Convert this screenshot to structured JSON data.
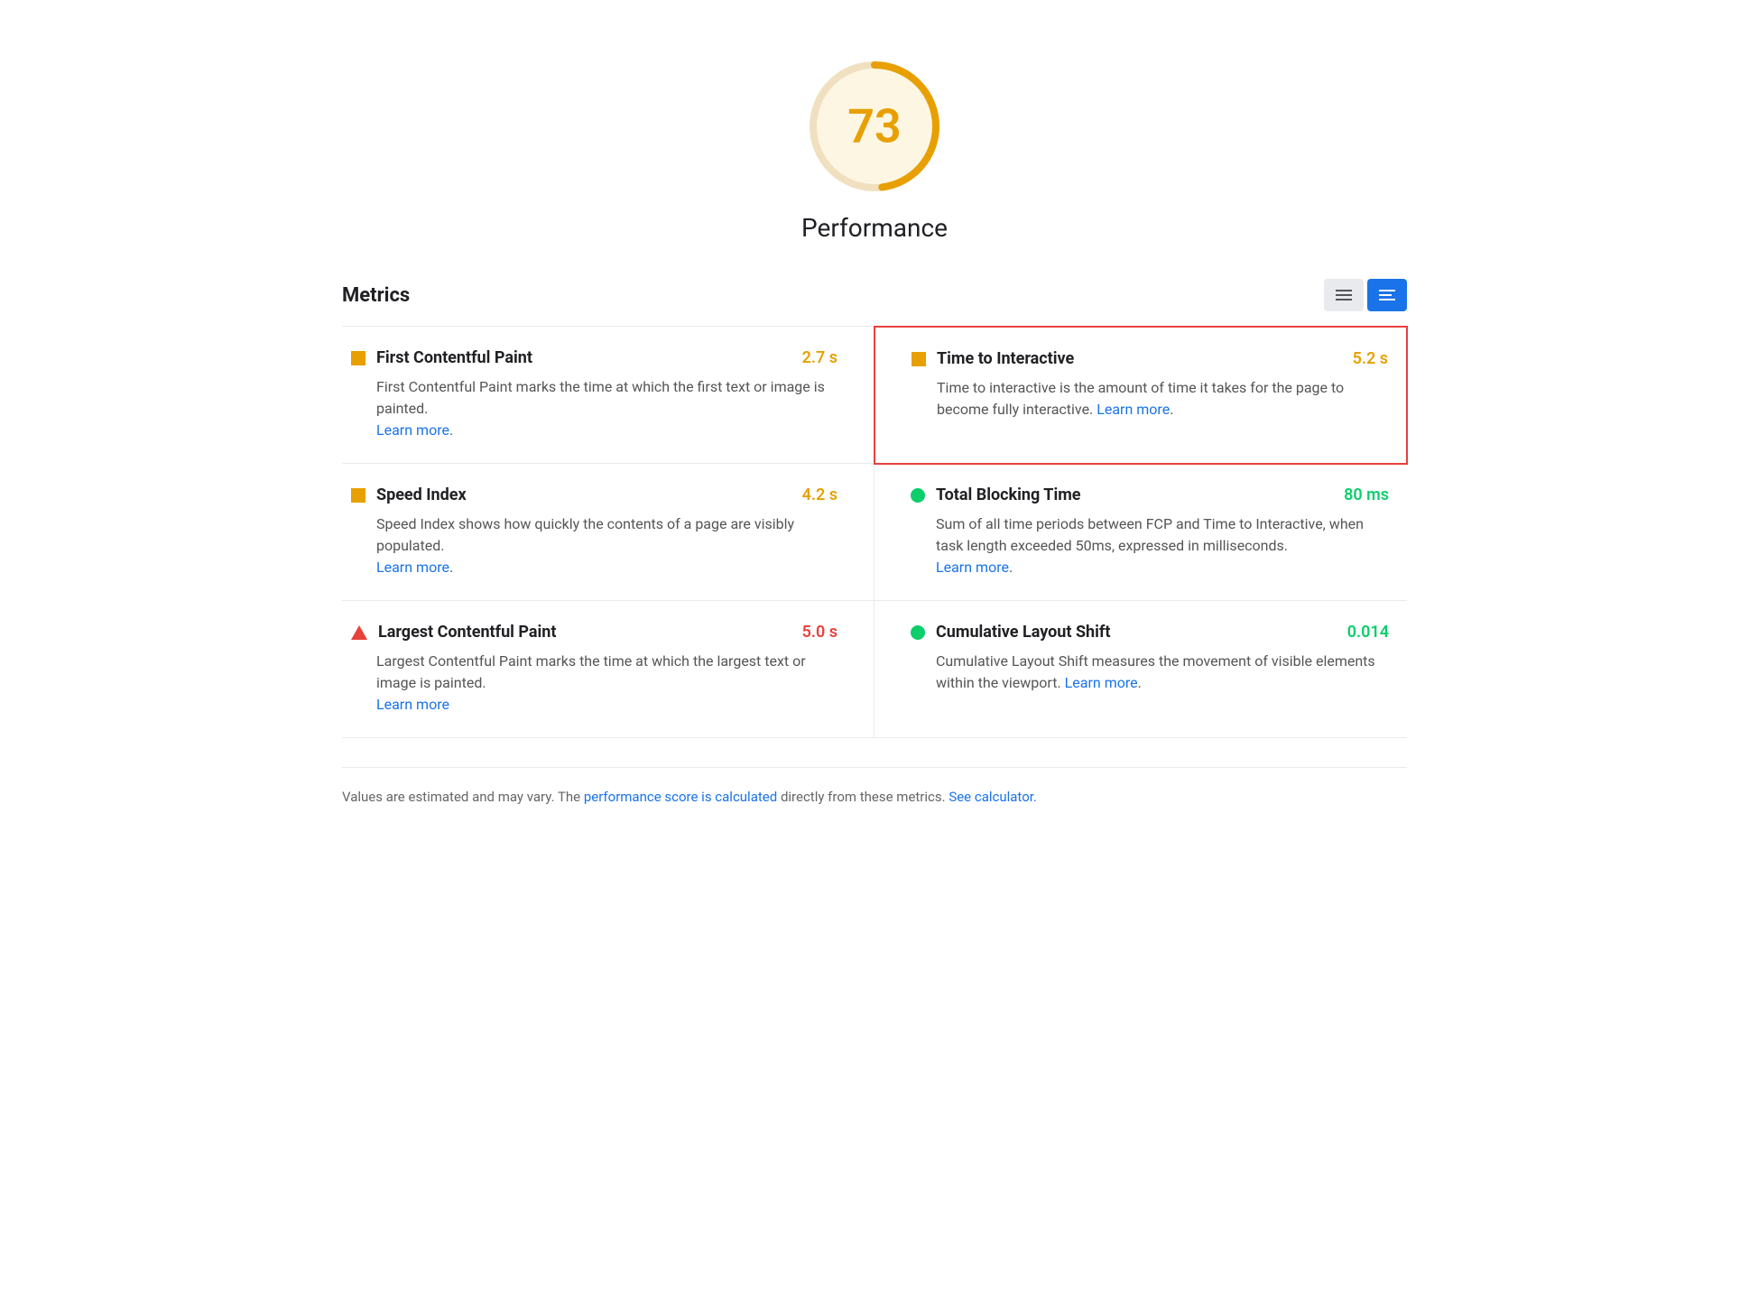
{
  "score": {
    "value": "73",
    "label": "Performance",
    "ring_color": "#e8a000",
    "bg_color": "#fdf6e3"
  },
  "metrics_section": {
    "title": "Metrics",
    "view_toggle": {
      "list_label": "list-view",
      "detail_label": "detail-view"
    }
  },
  "metrics": [
    {
      "id": "fcp",
      "name": "First Contentful Paint",
      "description": "First Contentful Paint marks the time at which the first text or image is painted.",
      "value": "2.7 s",
      "value_color": "orange",
      "icon_type": "square",
      "learn_more_url": "#",
      "learn_more_label": "Learn more",
      "highlighted": false
    },
    {
      "id": "tti",
      "name": "Time to Interactive",
      "description": "Time to interactive is the amount of time it takes for the page to become fully interactive.",
      "value": "5.2 s",
      "value_color": "orange",
      "icon_type": "square",
      "learn_more_url": "#",
      "learn_more_label": "Learn more",
      "highlighted": true
    },
    {
      "id": "si",
      "name": "Speed Index",
      "description": "Speed Index shows how quickly the contents of a page are visibly populated.",
      "value": "4.2 s",
      "value_color": "orange",
      "icon_type": "square",
      "learn_more_url": "#",
      "learn_more_label": "Learn more",
      "highlighted": false
    },
    {
      "id": "tbt",
      "name": "Total Blocking Time",
      "description": "Sum of all time periods between FCP and Time to Interactive, when task length exceeded 50ms, expressed in milliseconds.",
      "value": "80 ms",
      "value_color": "green",
      "icon_type": "circle",
      "learn_more_url": "#",
      "learn_more_label": "Learn more",
      "highlighted": false
    },
    {
      "id": "lcp",
      "name": "Largest Contentful Paint",
      "description": "Largest Contentful Paint marks the time at which the largest text or image is painted.",
      "value": "5.0 s",
      "value_color": "red",
      "icon_type": "triangle",
      "learn_more_url": "#",
      "learn_more_label": "Learn more",
      "highlighted": false
    },
    {
      "id": "cls",
      "name": "Cumulative Layout Shift",
      "description": "Cumulative Layout Shift measures the movement of visible elements within the viewport.",
      "value": "0.014",
      "value_color": "green",
      "icon_type": "circle",
      "learn_more_url": "#",
      "learn_more_label": "Learn more",
      "highlighted": false
    }
  ],
  "footer": {
    "text_before": "Values are estimated and may vary. The ",
    "link1_text": "performance score is calculated",
    "link1_url": "#",
    "text_middle": " directly from these metrics. ",
    "link2_text": "See calculator.",
    "link2_url": "#"
  }
}
